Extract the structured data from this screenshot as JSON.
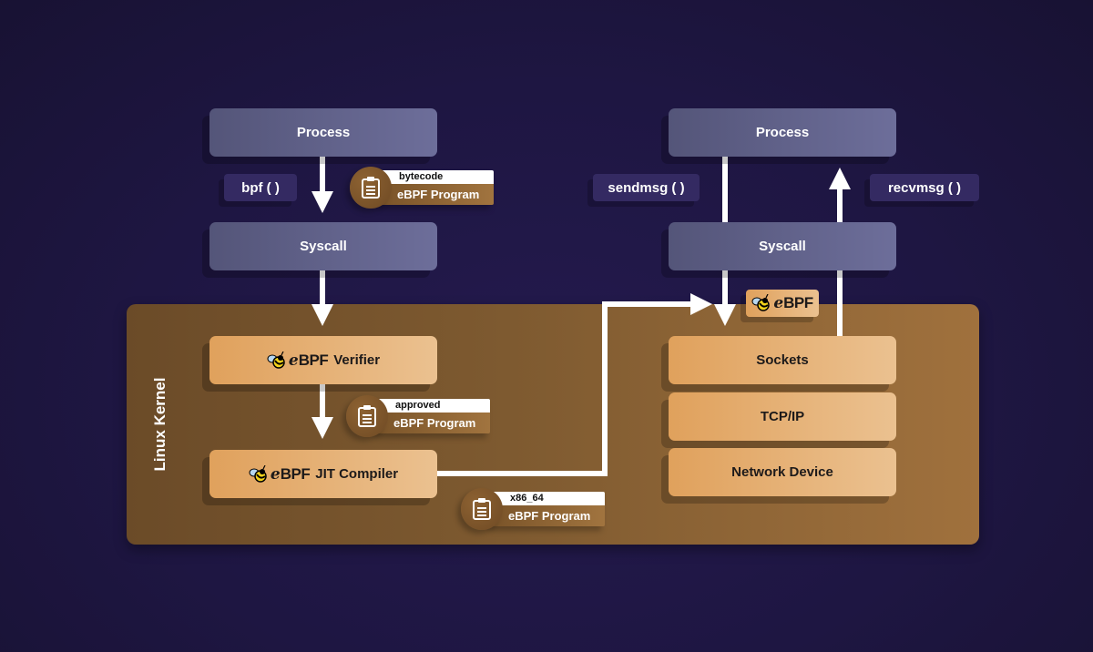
{
  "kernel": {
    "label": "Linux Kernel"
  },
  "left": {
    "process": "Process",
    "call": "bpf ( )",
    "syscall": "Syscall",
    "bytecode_program": {
      "tag": "bytecode",
      "name": "eBPF Program"
    },
    "verifier": {
      "logo": "eBPF",
      "label": "Verifier"
    },
    "approved_program": {
      "tag": "approved",
      "name": "eBPF Program"
    },
    "jit": {
      "logo": "eBPF",
      "label": "JIT Compiler"
    },
    "x86_program": {
      "tag": "x86_64",
      "name": "eBPF Program"
    }
  },
  "right": {
    "process": "Process",
    "send_call": "sendmsg ( )",
    "recv_call": "recvmsg ( )",
    "syscall": "Syscall",
    "ebpf_badge": "eBPF",
    "stack": [
      "Sockets",
      "TCP/IP",
      "Network Device"
    ]
  },
  "icons": {
    "program": "clipboard-icon",
    "logo": "bee-icon"
  },
  "colors": {
    "background": "#1e1642",
    "purple_box": "#6d6e9a",
    "orange_box": "#e0a15c",
    "kernel": "#7e5a30",
    "arrow": "#ffffff"
  }
}
